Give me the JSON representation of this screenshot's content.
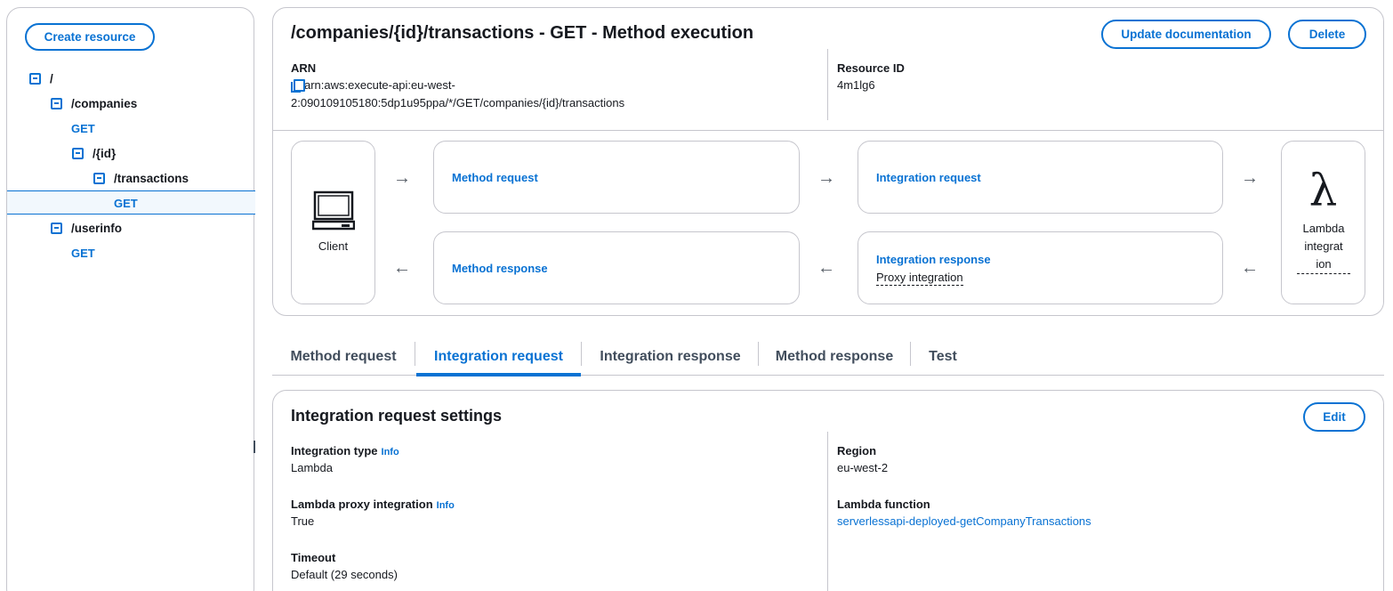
{
  "sidebar": {
    "create_resource_label": "Create resource",
    "tree": {
      "root": "/",
      "companies": "/companies",
      "companies_get": "GET",
      "id": "/{id}",
      "transactions": "/transactions",
      "transactions_get": "GET",
      "userinfo": "/userinfo",
      "userinfo_get": "GET"
    }
  },
  "header": {
    "title": "/companies/{id}/transactions - GET - Method execution",
    "update_documentation_label": "Update documentation",
    "delete_label": "Delete",
    "arn_label": "ARN",
    "arn_line1": "arn:aws:execute-api:eu-west-",
    "arn_line2": "2:090109105180:5dp1u95ppa/*/GET/companies/{id}/transactions",
    "resource_id_label": "Resource ID",
    "resource_id_value": "4m1lg6"
  },
  "flow": {
    "client_label": "Client",
    "method_request": "Method request",
    "integration_request": "Integration request",
    "integration_response": "Integration response",
    "integration_response_sub": "Proxy integration",
    "method_response": "Method response",
    "lambda_line1": "Lambda",
    "lambda_line2": "integrat",
    "lambda_line3": "ion",
    "lambda_symbol": "λ",
    "arrow_right": "→",
    "arrow_left": "←"
  },
  "tabs": [
    {
      "label": "Method request",
      "active": false
    },
    {
      "label": "Integration request",
      "active": true
    },
    {
      "label": "Integration response",
      "active": false
    },
    {
      "label": "Method response",
      "active": false
    },
    {
      "label": "Test",
      "active": false
    }
  ],
  "settings": {
    "title": "Integration request settings",
    "edit_label": "Edit",
    "info_label": "Info",
    "integration_type_label": "Integration type",
    "integration_type_value": "Lambda",
    "lambda_proxy_label": "Lambda proxy integration",
    "lambda_proxy_value": "True",
    "timeout_label": "Timeout",
    "timeout_value": "Default (29 seconds)",
    "region_label": "Region",
    "region_value": "eu-west-2",
    "lambda_function_label": "Lambda function",
    "lambda_function_value": "serverlessapi-deployed-getCompanyTransactions"
  },
  "colors": {
    "accent": "#0972d3",
    "border": "#c6c6cd",
    "text": "#16191f"
  }
}
